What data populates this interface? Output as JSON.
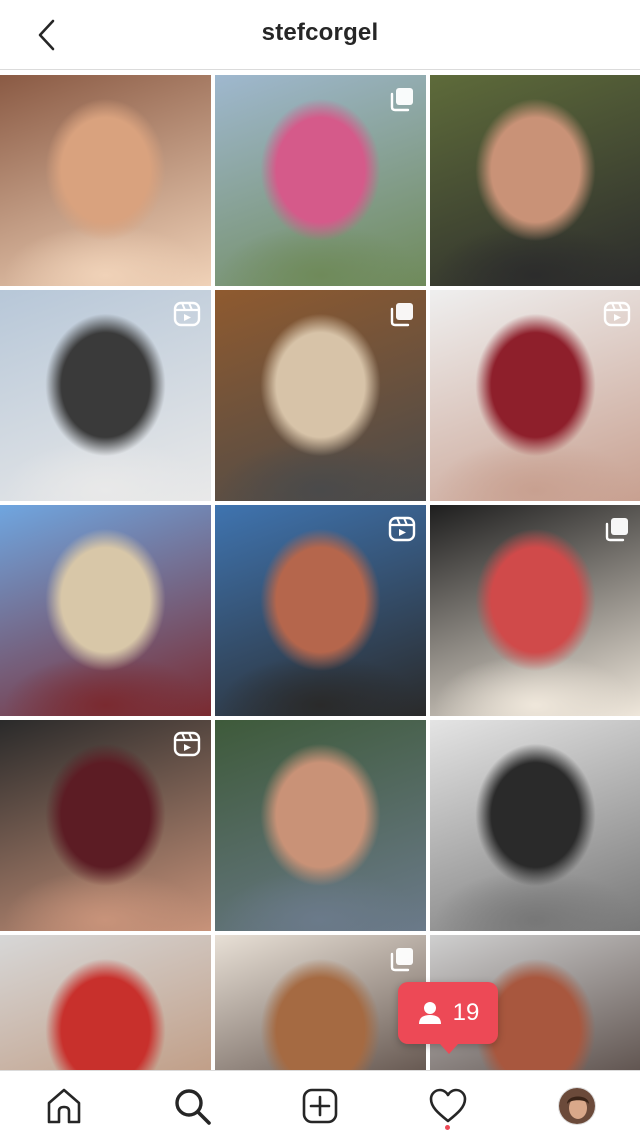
{
  "header": {
    "username": "stefcorgel",
    "back_icon": "chevron-left-icon"
  },
  "grid": {
    "posts": [
      {
        "name": "post-1",
        "badge": "",
        "palette": [
          "#8a5a44",
          "#d9a27e",
          "#f0d2b8"
        ]
      },
      {
        "name": "post-2",
        "badge": "carousel",
        "palette": [
          "#9fb8cf",
          "#d55a8a",
          "#6f8a5a"
        ]
      },
      {
        "name": "post-3",
        "badge": "",
        "palette": [
          "#5e6b3a",
          "#c99277",
          "#2c2c2c"
        ]
      },
      {
        "name": "post-4",
        "badge": "reel",
        "palette": [
          "#b7c7d8",
          "#3a3a3a",
          "#e9e9e9"
        ]
      },
      {
        "name": "post-5",
        "badge": "carousel",
        "palette": [
          "#8f5a2f",
          "#d7c3a8",
          "#4a4a4a"
        ]
      },
      {
        "name": "post-6",
        "badge": "reel",
        "palette": [
          "#efefef",
          "#8e1f2b",
          "#c8a090"
        ]
      },
      {
        "name": "post-7",
        "badge": "",
        "palette": [
          "#6fa6e0",
          "#d8c7a8",
          "#7a2a30"
        ]
      },
      {
        "name": "post-8",
        "badge": "reel",
        "palette": [
          "#3f74b0",
          "#b5664c",
          "#2a2a2a"
        ]
      },
      {
        "name": "post-9",
        "badge": "carousel",
        "palette": [
          "#1e1e1e",
          "#d04a4a",
          "#efe7db"
        ]
      },
      {
        "name": "post-10",
        "badge": "reel",
        "palette": [
          "#2a2a2a",
          "#5c1c24",
          "#c8937a"
        ]
      },
      {
        "name": "post-11",
        "badge": "",
        "palette": [
          "#3e5a3a",
          "#c99277",
          "#6b7a8a"
        ]
      },
      {
        "name": "post-12",
        "badge": "",
        "palette": [
          "#e4e4e4",
          "#2a2a2a",
          "#777777"
        ]
      },
      {
        "name": "post-13",
        "badge": "",
        "palette": [
          "#d7d7d7",
          "#c8302c",
          "#b98b6c"
        ]
      },
      {
        "name": "post-14",
        "badge": "carousel",
        "palette": [
          "#e8e0d6",
          "#a56a42",
          "#3a2a24"
        ]
      },
      {
        "name": "post-15",
        "badge": "",
        "palette": [
          "#cfcfcf",
          "#a8573e",
          "#3a2a24"
        ]
      }
    ]
  },
  "notification": {
    "count": "19",
    "icon": "person-icon",
    "color": "#ed4956"
  },
  "tabbar": {
    "items": [
      "home-icon",
      "search-icon",
      "new-post-icon",
      "activity-heart-icon",
      "profile-avatar"
    ]
  },
  "colors": {
    "text": "#262626",
    "border": "#dbdbdb",
    "accent": "#ed4956"
  }
}
